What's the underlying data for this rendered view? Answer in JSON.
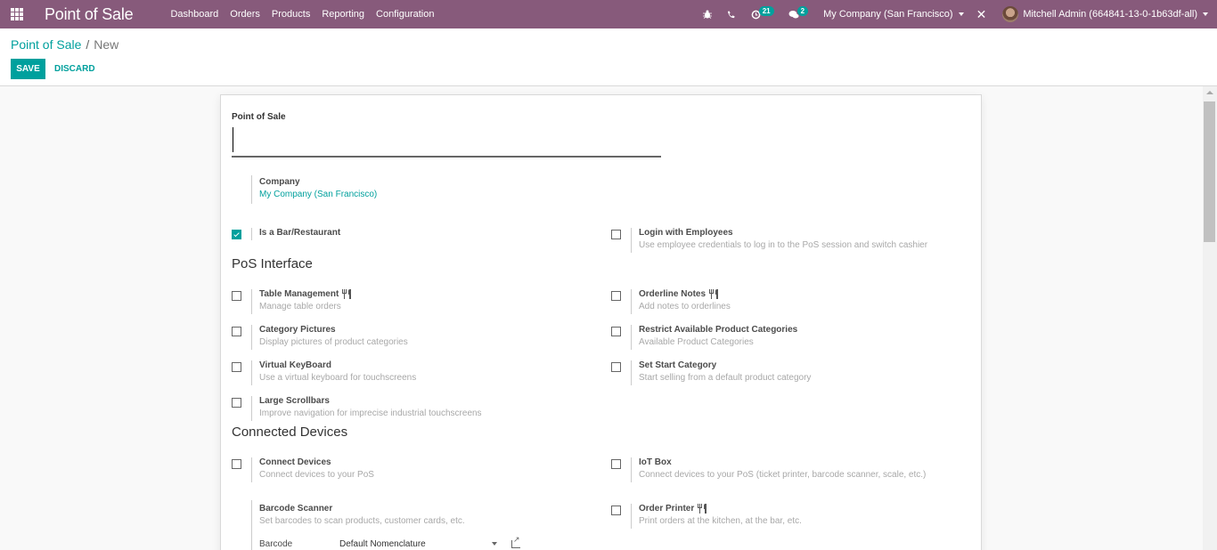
{
  "navbar": {
    "brand": "Point of Sale",
    "menu": [
      "Dashboard",
      "Orders",
      "Products",
      "Reporting",
      "Configuration"
    ],
    "activity_count": "21",
    "messages_count": "2",
    "company": "My Company (San Francisco)",
    "user": "Mitchell Admin (664841-13-0-1b63df-all)"
  },
  "breadcrumb": {
    "parent": "Point of Sale",
    "separator": "/",
    "current": "New"
  },
  "buttons": {
    "save": "SAVE",
    "discard": "DISCARD"
  },
  "form": {
    "name_label": "Point of Sale",
    "name_value": "",
    "company_label": "Company",
    "company_value": "My Company (San Francisco)",
    "is_bar": {
      "title": "Is a Bar/Restaurant",
      "checked": true
    },
    "login_employees": {
      "title": "Login with Employees",
      "desc": "Use employee credentials to log in to the PoS session and switch cashier",
      "checked": false
    },
    "sections": {
      "pos_interface": "PoS Interface",
      "connected_devices": "Connected Devices"
    },
    "interface_left": [
      {
        "title": "Table Management",
        "desc": "Manage table orders",
        "restaurant_icon": true,
        "checked": false
      },
      {
        "title": "Category Pictures",
        "desc": "Display pictures of product categories",
        "restaurant_icon": false,
        "checked": false
      },
      {
        "title": "Virtual KeyBoard",
        "desc": "Use a virtual keyboard for touchscreens",
        "restaurant_icon": false,
        "checked": false
      },
      {
        "title": "Large Scrollbars",
        "desc": "Improve navigation for imprecise industrial touchscreens",
        "restaurant_icon": false,
        "checked": false
      }
    ],
    "interface_right": [
      {
        "title": "Orderline Notes",
        "desc": "Add notes to orderlines",
        "restaurant_icon": true,
        "checked": false
      },
      {
        "title": "Restrict Available Product Categories",
        "desc": "Available Product Categories",
        "restaurant_icon": false,
        "checked": false
      },
      {
        "title": "Set Start Category",
        "desc": "Start selling from a default product category",
        "restaurant_icon": false,
        "checked": false
      }
    ],
    "devices": {
      "connect_devices": {
        "title": "Connect Devices",
        "desc": "Connect devices to your PoS",
        "checked": false
      },
      "iot_box": {
        "title": "IoT Box",
        "desc": "Connect devices to your PoS (ticket printer, barcode scanner, scale, etc.)",
        "checked": false
      },
      "barcode_scanner": {
        "title": "Barcode Scanner",
        "desc": "Set barcodes to scan products, customer cards, etc.",
        "field_label": "Barcode",
        "field_value": "Default Nomenclature"
      },
      "order_printer": {
        "title": "Order Printer",
        "desc": "Print orders at the kitchen, at the bar, etc.",
        "restaurant_icon": true,
        "checked": false
      }
    }
  },
  "colors": {
    "navbar": "#875a7b",
    "accent": "#00a09d"
  }
}
